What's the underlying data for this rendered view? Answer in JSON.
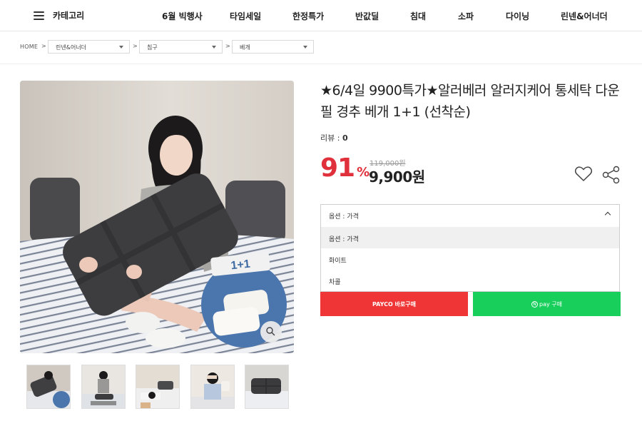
{
  "nav": {
    "category_label": "카테고리",
    "items": [
      {
        "label": "6월 빅행사"
      },
      {
        "label": "타임세일"
      },
      {
        "label": "한정특가"
      },
      {
        "label": "반값딜"
      },
      {
        "label": "침대"
      },
      {
        "label": "소파"
      },
      {
        "label": "다이닝"
      },
      {
        "label": "린넨&어너더"
      }
    ]
  },
  "breadcrumb": {
    "home": "HOME",
    "separator": ">",
    "selects": [
      "린넨&어너더",
      "침구",
      "베개"
    ]
  },
  "product": {
    "title": "★6/4일 9900특가★알러베러 알러지케어 통세탁 다운필 경추 베개 1+1 (선착순)",
    "review_label": "리뷰 :",
    "review_count": "0",
    "discount_value": "91",
    "discount_unit": "%",
    "original_price": "119,000원",
    "price": "9,900원"
  },
  "badge": {
    "text": "1+1"
  },
  "options": {
    "header": "옵션 : 가격",
    "items": [
      "옵션 : 가격",
      "화이트",
      "차콜"
    ],
    "selected_index": 0
  },
  "buttons": {
    "payco": "PAYCO 바로구매",
    "npay": "pay 구매",
    "npay_mark": "N"
  },
  "colors": {
    "discount": "#e0303b",
    "payco": "#ef3535",
    "npay": "#19cf5c"
  },
  "icons": {
    "menu": "hamburger-icon",
    "wishlist": "heart-icon",
    "share": "share-icon",
    "zoom": "search-icon",
    "dropdown": "chevron-up-icon"
  }
}
